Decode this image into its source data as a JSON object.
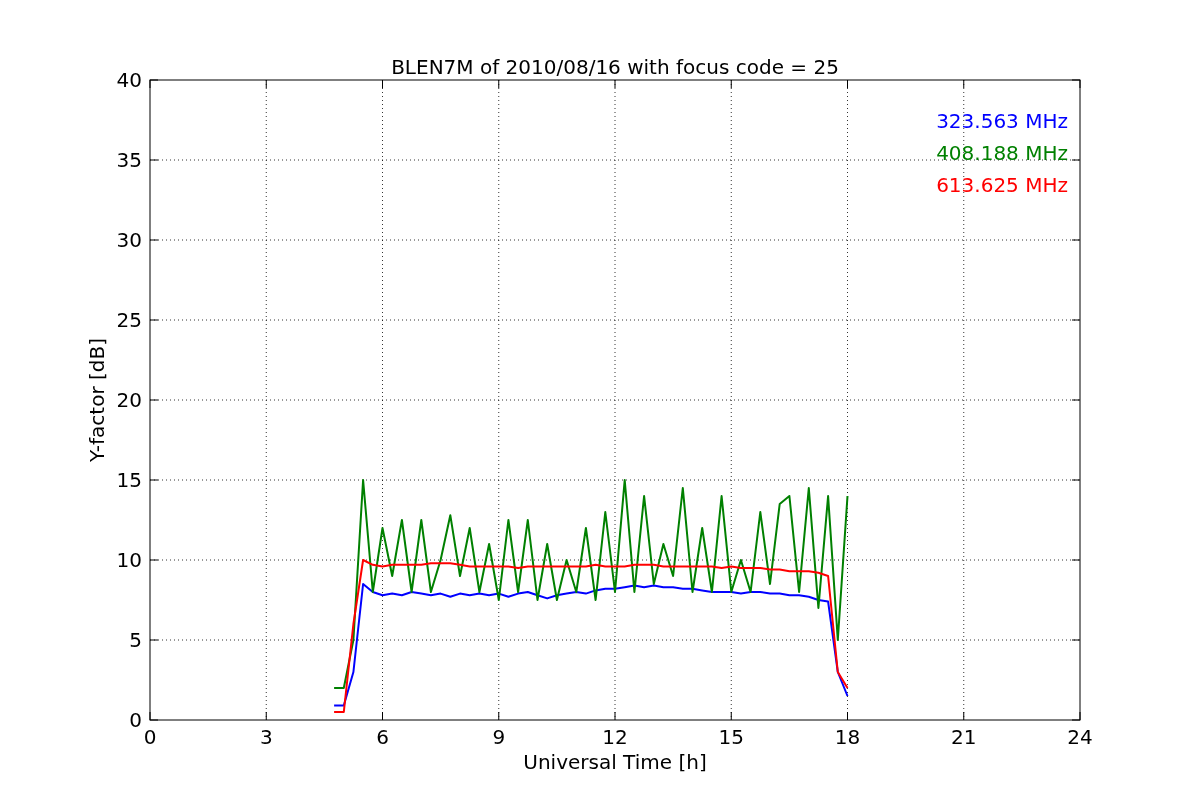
{
  "chart_data": {
    "type": "line",
    "title": "BLEN7M of 2010/08/16 with focus code = 25",
    "xlabel": "Universal Time [h]",
    "ylabel": "Y-factor [dB]",
    "xlim": [
      0,
      24
    ],
    "ylim": [
      0,
      40
    ],
    "xticks": [
      0,
      3,
      6,
      9,
      12,
      15,
      18,
      21,
      24
    ],
    "yticks": [
      0,
      5,
      10,
      15,
      20,
      25,
      30,
      35,
      40
    ],
    "x": [
      4.75,
      5,
      5.25,
      5.5,
      5.75,
      6,
      6.25,
      6.5,
      6.75,
      7,
      7.25,
      7.5,
      7.75,
      8,
      8.25,
      8.5,
      8.75,
      9,
      9.25,
      9.5,
      9.75,
      10,
      10.25,
      10.5,
      10.75,
      11,
      11.25,
      11.5,
      11.75,
      12,
      12.25,
      12.5,
      12.75,
      13,
      13.25,
      13.5,
      13.75,
      14,
      14.25,
      14.5,
      14.75,
      15,
      15.25,
      15.5,
      15.75,
      16,
      16.25,
      16.5,
      16.75,
      17,
      17.25,
      17.5,
      17.75,
      18
    ],
    "grid": true,
    "series": [
      {
        "name": "323.563 MHz",
        "color": "#0000ff",
        "values": [
          0.9,
          0.9,
          3,
          8.5,
          8,
          7.8,
          7.9,
          7.8,
          8,
          7.9,
          7.8,
          7.9,
          7.7,
          7.9,
          7.8,
          7.9,
          7.8,
          7.9,
          7.7,
          7.9,
          8,
          7.8,
          7.6,
          7.8,
          7.9,
          8,
          7.9,
          8.1,
          8.2,
          8.2,
          8.3,
          8.4,
          8.3,
          8.4,
          8.3,
          8.3,
          8.2,
          8.2,
          8.1,
          8,
          8,
          8,
          7.9,
          8,
          8,
          7.9,
          7.9,
          7.8,
          7.8,
          7.7,
          7.5,
          7.4,
          3,
          1.5
        ]
      },
      {
        "name": "408.188 MHz",
        "color": "#008000",
        "values": [
          2,
          2,
          5,
          15,
          8,
          12,
          9,
          12.5,
          8,
          12.5,
          8,
          10,
          12.8,
          9,
          12,
          8,
          11,
          7.5,
          12.5,
          8,
          12.5,
          7.5,
          11,
          7.5,
          10,
          8,
          12,
          7.5,
          13,
          8,
          15,
          8,
          14,
          8.5,
          11,
          9,
          14.5,
          8,
          12,
          8,
          14,
          8,
          10,
          8,
          13,
          8.5,
          13.5,
          14,
          8,
          14.5,
          7,
          14,
          5,
          14
        ]
      },
      {
        "name": "613.625 MHz",
        "color": "#ff0000",
        "values": [
          0.5,
          0.5,
          6,
          10,
          9.7,
          9.6,
          9.7,
          9.7,
          9.7,
          9.7,
          9.8,
          9.8,
          9.8,
          9.7,
          9.6,
          9.6,
          9.6,
          9.6,
          9.6,
          9.5,
          9.6,
          9.6,
          9.6,
          9.6,
          9.6,
          9.6,
          9.6,
          9.7,
          9.6,
          9.6,
          9.6,
          9.7,
          9.7,
          9.7,
          9.6,
          9.6,
          9.6,
          9.6,
          9.6,
          9.6,
          9.5,
          9.6,
          9.5,
          9.5,
          9.5,
          9.4,
          9.4,
          9.3,
          9.3,
          9.3,
          9.2,
          9,
          3,
          2
        ]
      }
    ]
  }
}
